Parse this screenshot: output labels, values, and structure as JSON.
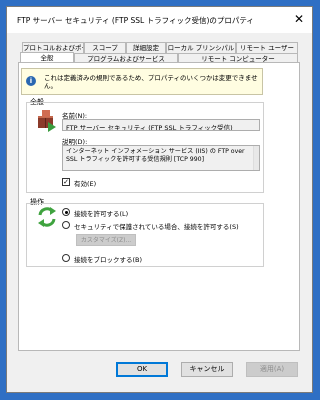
{
  "window": {
    "title": "FTP サーバー セキュリティ (FTP SSL トラフィック受信)のプロパティ"
  },
  "tabs_row1": [
    "プロトコルおよびポート",
    "スコープ",
    "詳細設定",
    "ローカル プリンシパル",
    "リモート ユーザー"
  ],
  "tabs_row2": [
    "全般",
    "プログラムおよびサービス",
    "リモート コンピューター"
  ],
  "info": {
    "text": "これは定義済みの規則であるため、プロパティのいくつかは変更できません。"
  },
  "general": {
    "group_label": "全般",
    "name_label": "名前(N):",
    "name_value": "FTP サーバー セキュリティ (FTP SSL トラフィック受信)",
    "desc_label": "説明(D):",
    "desc_value": "インターネット インフォメーション サービス (IIS) の FTP over SSL トラフィックを許可する受信規則 [TCP 990]",
    "enabled_label": "有効(E)"
  },
  "action": {
    "group_label": "操作",
    "allow": "接続を許可する(L)",
    "allow_secure": "セキュリティで保護されている場合、接続を許可する(S)",
    "customize": "カスタマイズ(Z)...",
    "block": "接続をブロックする(B)"
  },
  "buttons": {
    "ok": "OK",
    "cancel": "キャンセル",
    "apply": "適用(A)"
  }
}
